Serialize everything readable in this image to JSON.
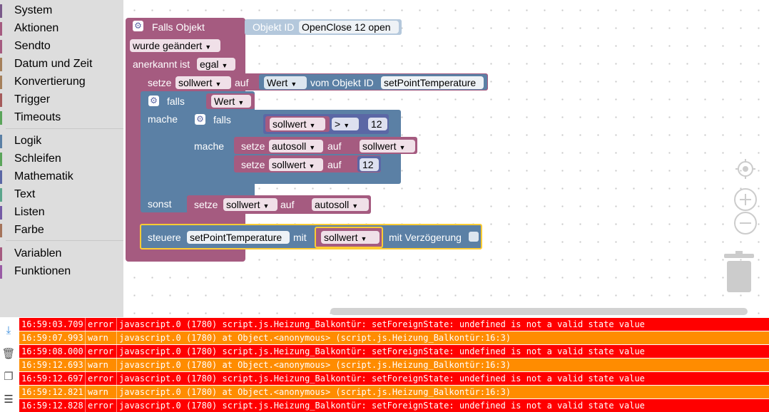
{
  "toolbox": {
    "items": [
      {
        "label": "System",
        "color": "#7a5a8a"
      },
      {
        "label": "Aktionen",
        "color": "#a55b80"
      },
      {
        "label": "Sendto",
        "color": "#a55b80"
      },
      {
        "label": "Datum und Zeit",
        "color": "#a5805b"
      },
      {
        "label": "Konvertierung",
        "color": "#a5805b"
      },
      {
        "label": "Trigger",
        "color": "#a55b5b"
      },
      {
        "label": "Timeouts",
        "color": "#5ba55b"
      },
      {
        "label": "Logik",
        "color": "#5b80a5"
      },
      {
        "label": "Schleifen",
        "color": "#5ba55b"
      },
      {
        "label": "Mathematik",
        "color": "#5b67a5"
      },
      {
        "label": "Text",
        "color": "#5ba58c"
      },
      {
        "label": "Listen",
        "color": "#745ba5"
      },
      {
        "label": "Farbe",
        "color": "#a5745b"
      },
      {
        "label": "Variablen",
        "color": "#a55b80"
      },
      {
        "label": "Funktionen",
        "color": "#995ba5"
      }
    ]
  },
  "workspace": {
    "colors": {
      "trigger": "#a55b80",
      "logic": "#5b80a5",
      "variable": "#a55b80",
      "math": "#5b67a5",
      "objectid": "#b4c8dc"
    },
    "trigger": {
      "title": "Falls Objekt",
      "objekt_id_label": "Objekt ID",
      "objekt_id_value": "OpenClose 12 open",
      "wurde_label": "wurde geändert",
      "anerkannt_label": "anerkannt ist",
      "anerkannt_value": "egal"
    },
    "set1": {
      "setze": "setze",
      "var": "sollwert",
      "auf": "auf",
      "wert": "Wert",
      "vom": "vom Objekt ID",
      "obj": "setPointTemperature"
    },
    "if_outer": {
      "falls": "falls",
      "cond": "Wert",
      "mache": "mache",
      "sonst": "sonst"
    },
    "if_inner": {
      "falls": "falls",
      "mache": "mache",
      "var": "sollwert",
      "op": ">",
      "num": "12"
    },
    "set2": {
      "setze": "setze",
      "var": "autosoll",
      "auf": "auf",
      "val": "sollwert"
    },
    "set3": {
      "setze": "setze",
      "var": "sollwert",
      "auf": "auf",
      "num": "12"
    },
    "set4": {
      "setze": "setze",
      "var": "sollwert",
      "auf": "auf",
      "val": "autosoll"
    },
    "steuere": {
      "label": "steuere",
      "obj": "setPointTemperature",
      "mit": "mit",
      "val": "sollwert",
      "delay": "mit Verzögerung"
    }
  },
  "log": {
    "colors": {
      "error": "#ff0000",
      "warn": "#ff8c00"
    },
    "rows": [
      {
        "time": "16:59:03.709",
        "level": "error",
        "msg": "javascript.0 (1780) script.js.Heizung_Balkontür: setForeignState: undefined is not a valid state value"
      },
      {
        "time": "16:59:07.993",
        "level": "warn",
        "msg": "javascript.0 (1780) at Object.<anonymous> (script.js.Heizung_Balkontür:16:3)"
      },
      {
        "time": "16:59:08.000",
        "level": "error",
        "msg": "javascript.0 (1780) script.js.Heizung_Balkontür: setForeignState: undefined is not a valid state value"
      },
      {
        "time": "16:59:12.693",
        "level": "warn",
        "msg": "javascript.0 (1780) at Object.<anonymous> (script.js.Heizung_Balkontür:16:3)"
      },
      {
        "time": "16:59:12.697",
        "level": "error",
        "msg": "javascript.0 (1780) script.js.Heizung_Balkontür: setForeignState: undefined is not a valid state value"
      },
      {
        "time": "16:59:12.821",
        "level": "warn",
        "msg": "javascript.0 (1780) at Object.<anonymous> (script.js.Heizung_Balkontür:16:3)"
      },
      {
        "time": "16:59:12.828",
        "level": "error",
        "msg": "javascript.0 (1780) script.js.Heizung_Balkontür: setForeignState: undefined is not a valid state value"
      }
    ]
  }
}
